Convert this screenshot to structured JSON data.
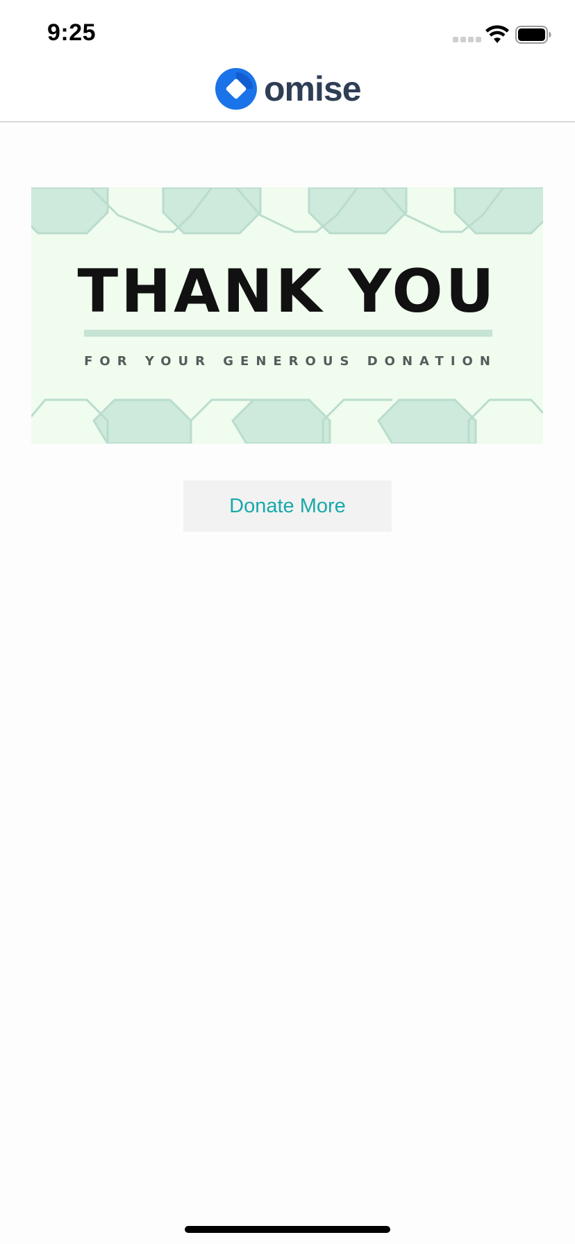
{
  "status_bar": {
    "time": "9:25",
    "icons": [
      "signal-dots-icon",
      "wifi-icon",
      "battery-icon"
    ]
  },
  "nav": {
    "brand_name": "omise",
    "logo_icon": "omise-logo-icon",
    "brand_color": "#2e3e55",
    "logo_color": "#1a73e8"
  },
  "banner": {
    "title": "THANK YOU",
    "subtitle": "FOR YOUR GENEROUS DONATION",
    "background_color": "#f0fcee",
    "pattern_color": "#cdeadd"
  },
  "actions": {
    "donate_more_label": "Donate More",
    "accent_color": "#1aa8aa"
  }
}
